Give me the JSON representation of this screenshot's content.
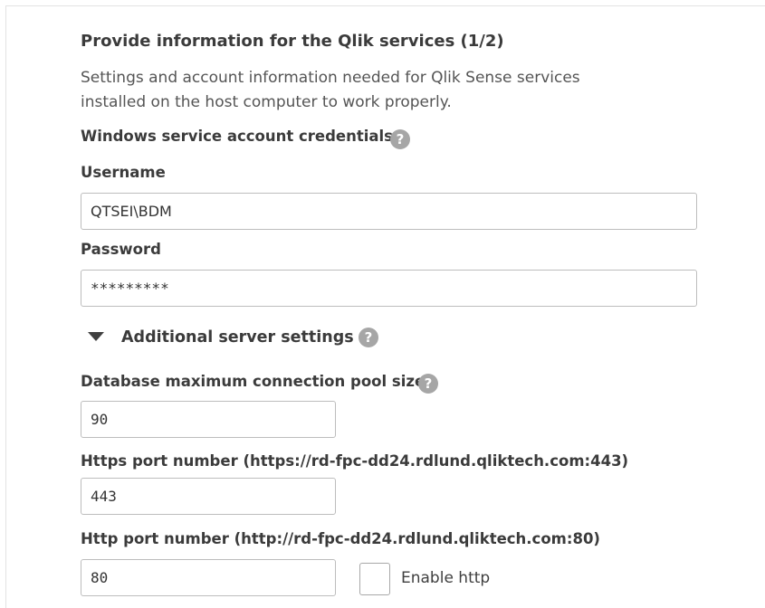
{
  "section": {
    "title": "Provide information for the Qlik services (1/2)",
    "description": "Settings and account information needed for Qlik Sense services installed on the host computer to work properly."
  },
  "credentials": {
    "heading": "Windows service account credentials",
    "username_label": "Username",
    "username_value": "QTSEI\\BDM",
    "password_label": "Password",
    "password_value": "*********"
  },
  "additional": {
    "toggle_label": "Additional server settings",
    "pool_label": "Database maximum connection pool size",
    "pool_value": "90",
    "https_label": "Https port number (https://rd-fpc-dd24.rdlund.qliktech.com:443)",
    "https_value": "443",
    "http_label": "Http port number (http://rd-fpc-dd24.rdlund.qliktech.com:80)",
    "http_value": "80",
    "enable_http_label": "Enable http",
    "enable_http_checked": false
  },
  "icons": {
    "help": "?"
  }
}
